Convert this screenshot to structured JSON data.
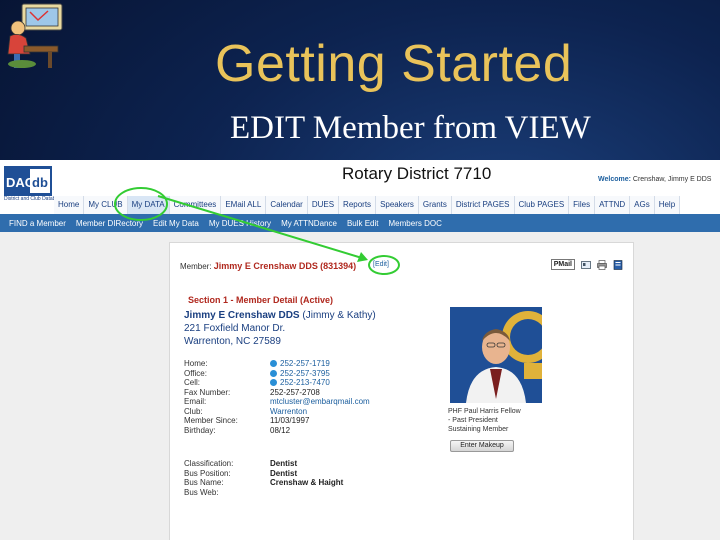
{
  "slide": {
    "title": "Getting Started",
    "subtitle": "EDIT Member from VIEW"
  },
  "logo": {
    "text": "DACdb",
    "subtitle": "District and Club Database"
  },
  "header": {
    "site_title": "Rotary District 7710",
    "welcome_label": "Welcome:",
    "welcome_user": "Crenshaw, Jimmy E DDS"
  },
  "menu_primary": [
    {
      "label": "Home"
    },
    {
      "label": "My CLUB"
    },
    {
      "label": "My DATA"
    },
    {
      "label": "Committees"
    },
    {
      "label": "EMail ALL"
    },
    {
      "label": "Calendar"
    },
    {
      "label": "DUES"
    },
    {
      "label": "Reports"
    },
    {
      "label": "Speakers"
    },
    {
      "label": "Grants"
    },
    {
      "label": "District PAGES"
    },
    {
      "label": "Club PAGES"
    },
    {
      "label": "Files"
    },
    {
      "label": "ATTND"
    },
    {
      "label": "AGs"
    },
    {
      "label": "Help"
    }
  ],
  "menu_secondary": [
    {
      "label": "FIND a Member"
    },
    {
      "label": "Member DIRectory"
    },
    {
      "label": "Edit My Data"
    },
    {
      "label": "My DUES History"
    },
    {
      "label": "My ATTNDance"
    },
    {
      "label": "Bulk Edit"
    },
    {
      "label": "Members DOC"
    }
  ],
  "member": {
    "label": "Member:",
    "name": "Jimmy E Crenshaw DDS",
    "id": "(831394)",
    "edit_label": "[Edit]",
    "pmail_label": "PMail",
    "section_title": "Section 1 - Member Detail (Active)",
    "display_name": "Jimmy E Crenshaw DDS",
    "nickname": "(Jimmy & Kathy)",
    "address1": "221 Foxfield Manor Dr.",
    "address2": "Warrenton, NC   27589",
    "fields": [
      {
        "label": "Home:",
        "value": "252-257-1719",
        "type": "phone"
      },
      {
        "label": "Office:",
        "value": "252-257-3795",
        "type": "phone"
      },
      {
        "label": "Cell:",
        "value": "252-213-7470",
        "type": "phone"
      },
      {
        "label": "Fax Number:",
        "value": "252-257-2708",
        "type": "text"
      },
      {
        "label": "Email:",
        "value": "mtcluster@embarqmail.com",
        "type": "link"
      },
      {
        "label": "Club:",
        "value": "Warrenton",
        "type": "link"
      },
      {
        "label": "Member Since:",
        "value": "11/03/1997",
        "type": "text"
      },
      {
        "label": "Birthday:",
        "value": "08/12",
        "type": "text"
      }
    ],
    "business": [
      {
        "label": "Classification:",
        "value": "Dentist"
      },
      {
        "label": "Bus Position:",
        "value": "Dentist"
      },
      {
        "label": "Bus Name:",
        "value": "Crenshaw & Haight"
      },
      {
        "label": "Bus Web:",
        "value": ""
      }
    ],
    "honors": [
      "PHF  Paul Harris Fellow",
      "- Past President",
      "  Sustaining Member"
    ],
    "makeup_button": "Enter Makeup"
  },
  "colors": {
    "slide_bg": "#0d2350",
    "title_gold": "#e9c35a",
    "menu_blue": "#2f6dad",
    "accent_red": "#b0281e",
    "highlight_green": "#33cc33"
  }
}
